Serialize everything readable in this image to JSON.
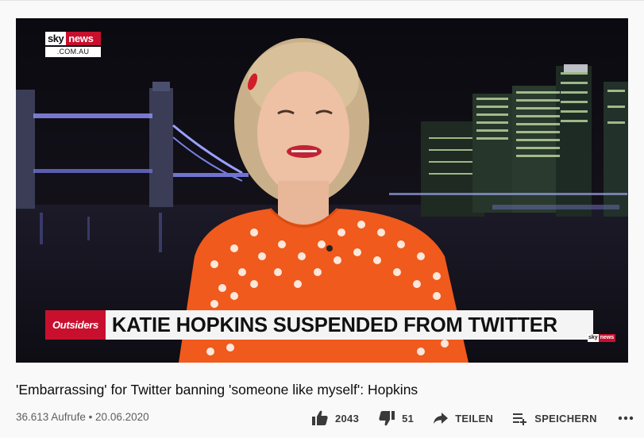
{
  "video": {
    "channel_logo": {
      "sky": "sky",
      "news": "news",
      "domain": ".COM.AU"
    },
    "lower_third": {
      "show": "Outsiders",
      "headline": "KATIE HOPKINS SUSPENDED FROM TWITTER"
    },
    "mini_logo": {
      "sky": "sky",
      "news": "news"
    }
  },
  "title": "'Embarrassing' for Twitter banning 'someone like myself': Hopkins",
  "views_date": "36.613 Aufrufe • 20.06.2020",
  "actions": {
    "likes": "2043",
    "dislikes": "51",
    "share": "TEILEN",
    "save": "SPEICHERN",
    "more_icon": "more-horizontal-icon"
  },
  "colors": {
    "brand_red": "#c8102e",
    "accent_orange": "#f05a1c"
  }
}
